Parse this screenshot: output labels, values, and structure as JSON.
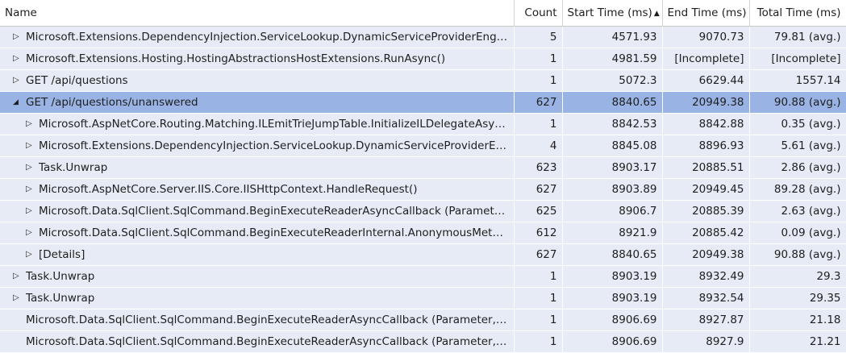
{
  "columns": {
    "name": "Name",
    "count": "Count",
    "start": "Start Time (ms)",
    "end": "End Time (ms)",
    "total": "Total Time (ms)"
  },
  "sort": {
    "column": "start",
    "direction": "ascending"
  },
  "rows": [
    {
      "name": "Microsoft.Extensions.DependencyInjection.ServiceLookup.DynamicServiceProviderEngine.CreateServiceAccessor()",
      "count": "5",
      "start": "4571.93",
      "end": "9070.73",
      "total": "79.81 (avg.)",
      "level": 0,
      "expander": "collapsed"
    },
    {
      "name": "Microsoft.Extensions.Hosting.HostingAbstractionsHostExtensions.RunAsync()",
      "count": "1",
      "start": "4981.59",
      "end": "[Incomplete]",
      "total": "[Incomplete]",
      "level": 0,
      "expander": "collapsed"
    },
    {
      "name": "GET /api/questions",
      "count": "1",
      "start": "5072.3",
      "end": "6629.44",
      "total": "1557.14",
      "level": 0,
      "expander": "collapsed"
    },
    {
      "name": "GET /api/questions/unanswered",
      "count": "627",
      "start": "8840.65",
      "end": "20949.38",
      "total": "90.88 (avg.)",
      "level": 0,
      "expander": "expanded",
      "selected": true
    },
    {
      "name": "Microsoft.AspNetCore.Routing.Matching.ILEmitTrieJumpTable.InitializeILDelegateAsync()",
      "count": "1",
      "start": "8842.53",
      "end": "8842.88",
      "total": "0.35 (avg.)",
      "level": 1,
      "expander": "collapsed"
    },
    {
      "name": "Microsoft.Extensions.DependencyInjection.ServiceLookup.DynamicServiceProviderEngine.CreateServiceAccessor()",
      "count": "4",
      "start": "8845.08",
      "end": "8896.93",
      "total": "5.61 (avg.)",
      "level": 1,
      "expander": "collapsed"
    },
    {
      "name": "Task.Unwrap",
      "count": "623",
      "start": "8903.17",
      "end": "20885.51",
      "total": "2.86 (avg.)",
      "level": 1,
      "expander": "collapsed"
    },
    {
      "name": "Microsoft.AspNetCore.Server.IIS.Core.IISHttpContext.HandleRequest()",
      "count": "627",
      "start": "8903.89",
      "end": "20949.45",
      "total": "89.28 (avg.)",
      "level": 1,
      "expander": "collapsed"
    },
    {
      "name": "Microsoft.Data.SqlClient.SqlCommand.BeginExecuteReaderAsyncCallback (Parameter, Parameter)",
      "count": "625",
      "start": "8906.7",
      "end": "20885.39",
      "total": "2.63 (avg.)",
      "level": 1,
      "expander": "collapsed"
    },
    {
      "name": "Microsoft.Data.SqlClient.SqlCommand.BeginExecuteReaderInternal.AnonymousMethod()",
      "count": "612",
      "start": "8921.9",
      "end": "20885.42",
      "total": "0.09 (avg.)",
      "level": 1,
      "expander": "collapsed"
    },
    {
      "name": "[Details]",
      "count": "627",
      "start": "8840.65",
      "end": "20949.38",
      "total": "90.88 (avg.)",
      "level": 1,
      "expander": "collapsed"
    },
    {
      "name": "Task.Unwrap",
      "count": "1",
      "start": "8903.19",
      "end": "8932.49",
      "total": "29.3",
      "level": 0,
      "expander": "collapsed"
    },
    {
      "name": "Task.Unwrap",
      "count": "1",
      "start": "8903.19",
      "end": "8932.54",
      "total": "29.35",
      "level": 0,
      "expander": "collapsed"
    },
    {
      "name": "Microsoft.Data.SqlClient.SqlCommand.BeginExecuteReaderAsyncCallback (Parameter, Parameter)",
      "count": "1",
      "start": "8906.69",
      "end": "8927.87",
      "total": "21.18",
      "level": 0,
      "expander": "none"
    },
    {
      "name": "Microsoft.Data.SqlClient.SqlCommand.BeginExecuteReaderAsyncCallback (Parameter, Parameter)",
      "count": "1",
      "start": "8906.69",
      "end": "8927.9",
      "total": "21.21",
      "level": 0,
      "expander": "none"
    }
  ],
  "colors": {
    "row_bg": "#e6ebf5",
    "selected_bg": "#99b4e4"
  }
}
